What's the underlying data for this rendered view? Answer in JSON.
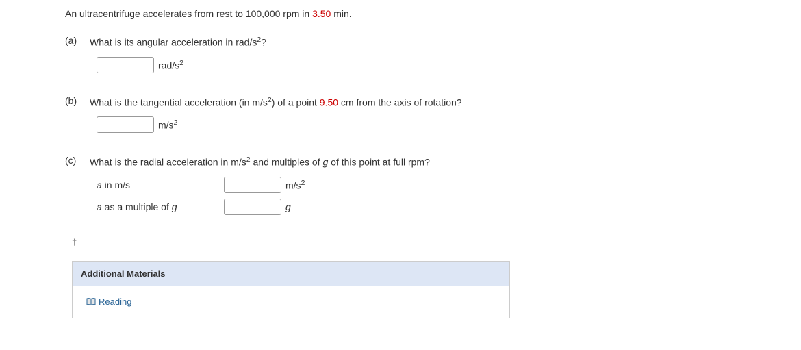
{
  "problem": {
    "text_before": "An ultracentrifuge accelerates from rest to 100,000 rpm in ",
    "highlight": "3.50",
    "text_after": " min."
  },
  "parts": {
    "a": {
      "label": "(a)",
      "question": "What is its angular acceleration in rad/s",
      "question_sup": "2",
      "question_after": "?",
      "unit_before": "rad/s",
      "unit_sup": "2"
    },
    "b": {
      "label": "(b)",
      "q_before": "What is the tangential acceleration (in m/s",
      "q_sup1": "2",
      "q_mid": ") of a point ",
      "q_highlight": "9.50",
      "q_after": " cm from the axis of rotation?",
      "unit_before": "m/s",
      "unit_sup": "2"
    },
    "c": {
      "label": "(c)",
      "q_before": "What is the radial acceleration in m/s",
      "q_sup1": "2",
      "q_mid": " and multiples of ",
      "q_italic": "g",
      "q_after": " of this point at full rpm?",
      "row1": {
        "label_italic": "a",
        "label_after": " in m/s",
        "unit_before": "m/s",
        "unit_sup": "2"
      },
      "row2": {
        "label_italic": "a",
        "label_mid": " as a multiple of ",
        "label_italic2": "g",
        "unit_italic": "g"
      }
    }
  },
  "dagger": "†",
  "additional": {
    "header": "Additional Materials",
    "link": "Reading"
  }
}
